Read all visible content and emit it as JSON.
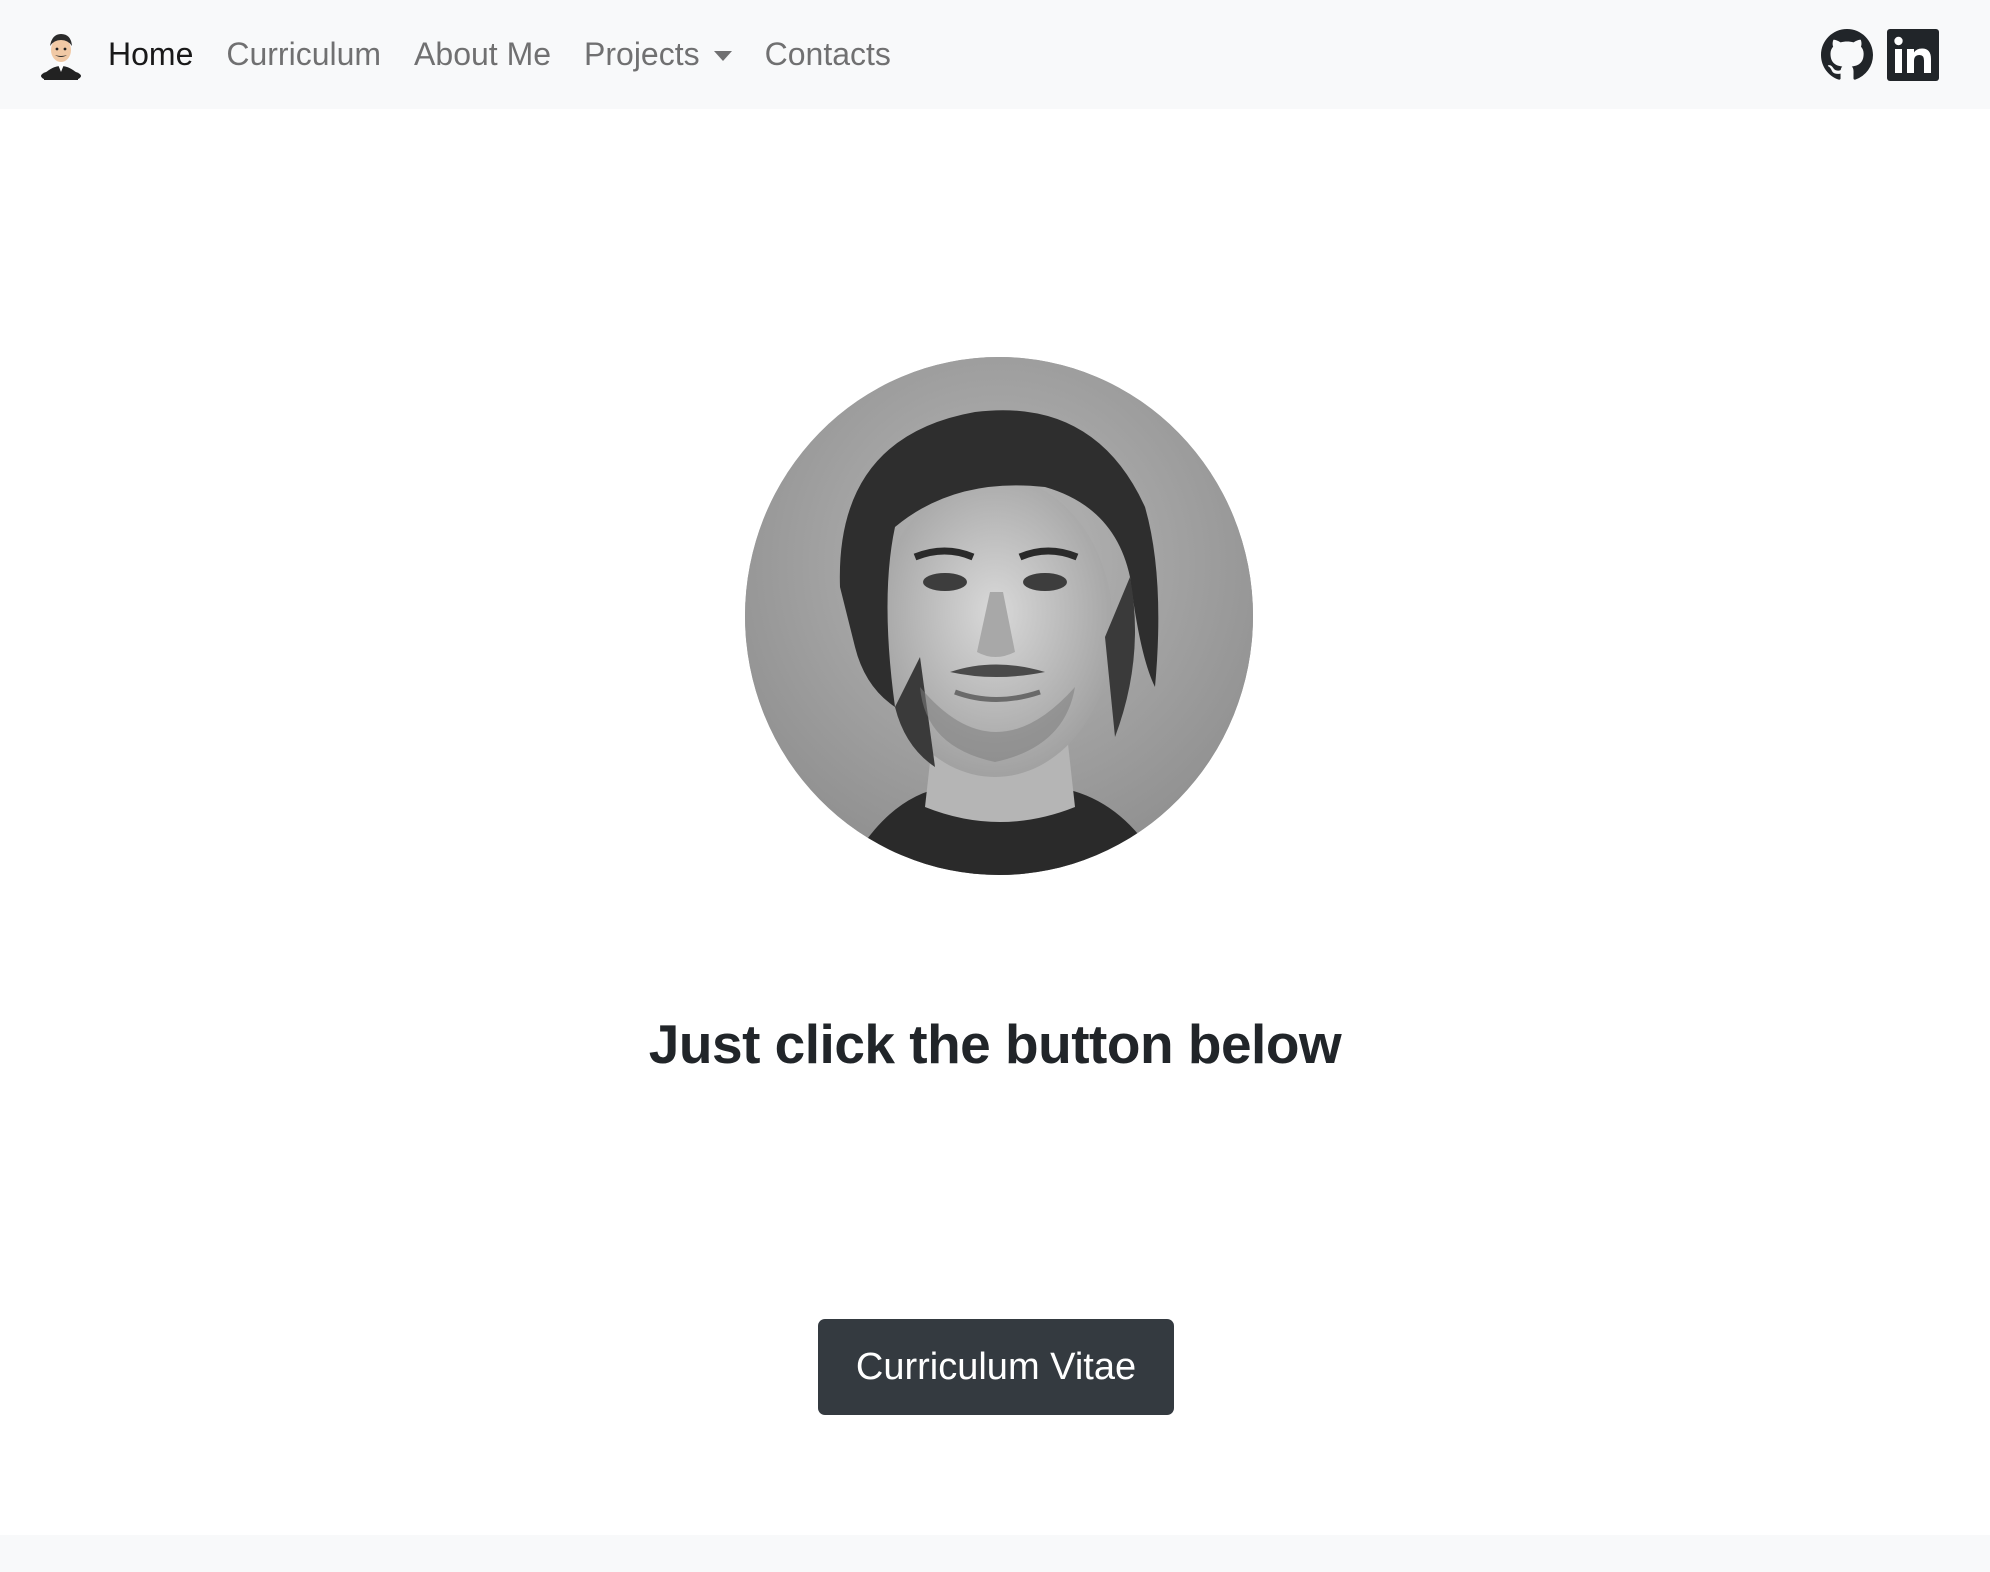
{
  "navbar": {
    "brand_icon": "avatar-cartoon-icon",
    "links": [
      {
        "label": "Home",
        "active": true
      },
      {
        "label": "Curriculum",
        "active": false
      },
      {
        "label": "About Me",
        "active": false
      },
      {
        "label": "Projects",
        "active": false,
        "dropdown": true
      },
      {
        "label": "Contacts",
        "active": false
      }
    ],
    "social": {
      "github_icon": "github-icon",
      "linkedin_icon": "linkedin-icon"
    }
  },
  "hero": {
    "headline": "Just click the button below",
    "button_label": "Curriculum Vitae"
  },
  "colors": {
    "navbar_bg": "#f8f9fa",
    "button_bg": "#343a40",
    "text_dark": "#212529"
  }
}
